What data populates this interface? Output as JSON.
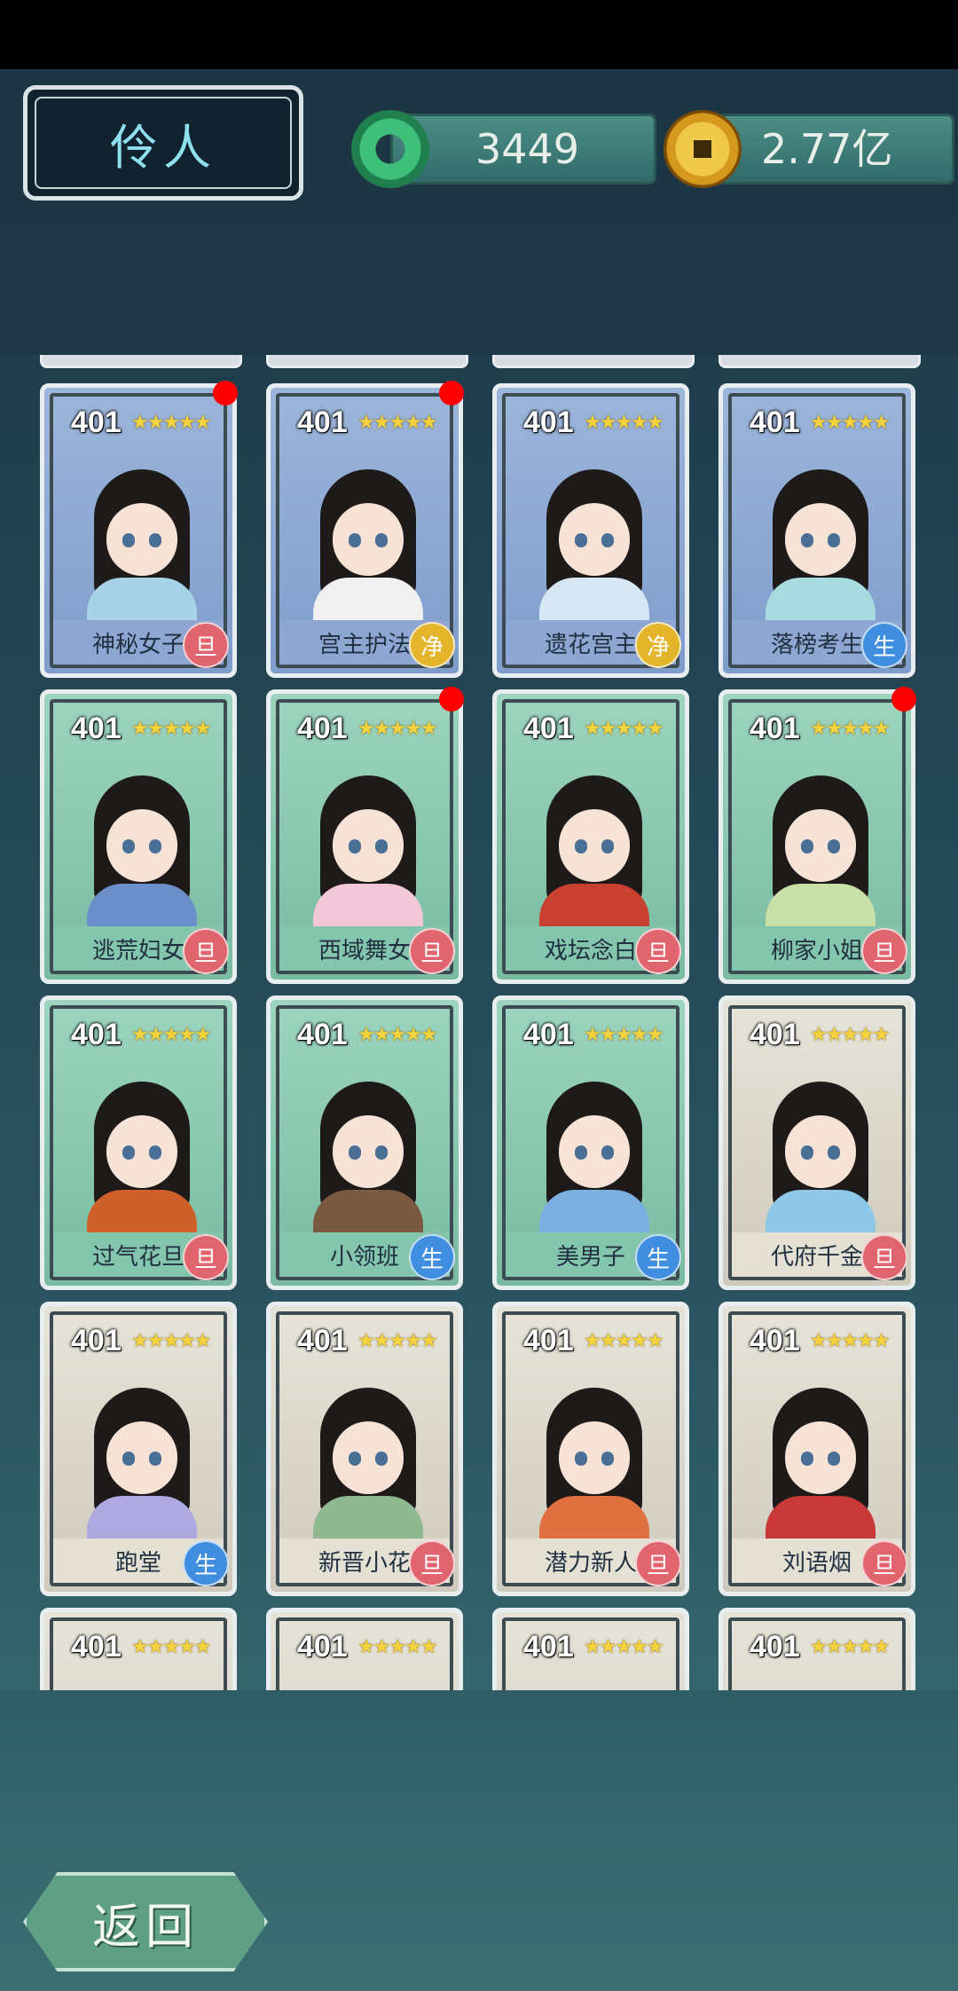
{
  "header": {
    "title": "伶人",
    "jade_count": "3449",
    "coin_count": "2.77亿"
  },
  "footer": {
    "back_label": "返回"
  },
  "star_text": "★★★★★",
  "cards": [
    {
      "level": "401",
      "name": "神秘女子",
      "badge": "旦",
      "theme": "blue",
      "badge_color": "red",
      "dot": true,
      "robe": "#a8d2e8"
    },
    {
      "level": "401",
      "name": "宫主护法",
      "badge": "净",
      "theme": "blue",
      "badge_color": "yellow",
      "dot": true,
      "robe": "#f0f0f0"
    },
    {
      "level": "401",
      "name": "遗花宫主",
      "badge": "净",
      "theme": "blue",
      "badge_color": "yellow",
      "dot": false,
      "robe": "#d6e6f2"
    },
    {
      "level": "401",
      "name": "落榜考生",
      "badge": "生",
      "theme": "blue",
      "badge_color": "blue",
      "dot": false,
      "robe": "#a8dbe0"
    },
    {
      "level": "401",
      "name": "逃荒妇女",
      "badge": "旦",
      "theme": "green",
      "badge_color": "red",
      "dot": false,
      "robe": "#6b8fc8"
    },
    {
      "level": "401",
      "name": "西域舞女",
      "badge": "旦",
      "theme": "green",
      "badge_color": "red",
      "dot": true,
      "robe": "#f2c8d8"
    },
    {
      "level": "401",
      "name": "戏坛念白",
      "badge": "旦",
      "theme": "green",
      "badge_color": "red",
      "dot": false,
      "robe": "#c84030"
    },
    {
      "level": "401",
      "name": "柳家小姐",
      "badge": "旦",
      "theme": "green",
      "badge_color": "red",
      "dot": true,
      "robe": "#c8e0a8"
    },
    {
      "level": "401",
      "name": "过气花旦",
      "badge": "旦",
      "theme": "green",
      "badge_color": "red",
      "dot": false,
      "robe": "#d0602a"
    },
    {
      "level": "401",
      "name": "小领班",
      "badge": "生",
      "theme": "green",
      "badge_color": "blue",
      "dot": false,
      "robe": "#7a5a40"
    },
    {
      "level": "401",
      "name": "美男子",
      "badge": "生",
      "theme": "green",
      "badge_color": "blue",
      "dot": false,
      "robe": "#7ab0e0"
    },
    {
      "level": "401",
      "name": "代府千金",
      "badge": "旦",
      "theme": "gray",
      "badge_color": "red",
      "dot": false,
      "robe": "#8ec8e8"
    },
    {
      "level": "401",
      "name": "跑堂",
      "badge": "生",
      "theme": "gray",
      "badge_color": "blue",
      "dot": false,
      "robe": "#b0a8e0"
    },
    {
      "level": "401",
      "name": "新晋小花",
      "badge": "旦",
      "theme": "gray",
      "badge_color": "red",
      "dot": false,
      "robe": "#8eb890"
    },
    {
      "level": "401",
      "name": "潜力新人",
      "badge": "旦",
      "theme": "gray",
      "badge_color": "red",
      "dot": false,
      "robe": "#e07040"
    },
    {
      "level": "401",
      "name": "刘语烟",
      "badge": "旦",
      "theme": "gray",
      "badge_color": "red",
      "dot": false,
      "robe": "#c83838"
    },
    {
      "level": "401",
      "name": "",
      "badge": "",
      "theme": "gray",
      "badge_color": "red",
      "dot": false,
      "robe": "#c8a070"
    },
    {
      "level": "401",
      "name": "",
      "badge": "",
      "theme": "gray",
      "badge_color": "red",
      "dot": false,
      "robe": "#303030"
    },
    {
      "level": "401",
      "name": "",
      "badge": "",
      "theme": "gray",
      "badge_color": "red",
      "dot": false,
      "robe": "#c8c8c8"
    },
    {
      "level": "401",
      "name": "",
      "badge": "",
      "theme": "gray",
      "badge_color": "red",
      "dot": false,
      "robe": "#f0f0f0"
    }
  ]
}
